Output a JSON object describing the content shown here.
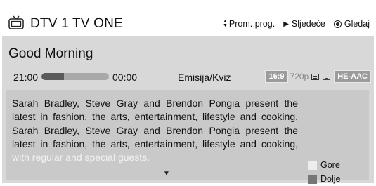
{
  "header": {
    "channel_label": "DTV 1  TV ONE",
    "controls": [
      {
        "icon": "up-down-arrows-icon",
        "label": "Prom. prog."
      },
      {
        "icon": "play-triangle-icon",
        "label": "Sljedeće"
      },
      {
        "icon": "ok-button-icon",
        "label": "Gledaj"
      }
    ]
  },
  "program": {
    "title": "Good Morning",
    "start_time": "21:00",
    "end_time": "00:00",
    "progress": 0.33,
    "genre": "Emisija/Kviz",
    "aspect_badge": "16:9",
    "resolution": "720p",
    "audio_badge": "HE-AAC"
  },
  "description": {
    "text_main": "Sarah Bradley, Steve Gray and Brendon Pongia present the latest in fashion, the arts, entertainment, lifestyle and cooking, Sarah Bradley, Steve Gray and Brendon Pongia present the latest in fashion, the arts, entertainment, lifestyle and cooking,",
    "text_faded": "with regular and special guests.",
    "scroll_symbol": "▼"
  },
  "legend": {
    "up_label": "Gore",
    "down_label": "Dolje"
  },
  "colors": {
    "panel_bg": "#d8d8d8",
    "desc_bg": "#c9c9c9",
    "progress_fill": "#5a5a5a",
    "progress_track": "#a8a8a8"
  }
}
